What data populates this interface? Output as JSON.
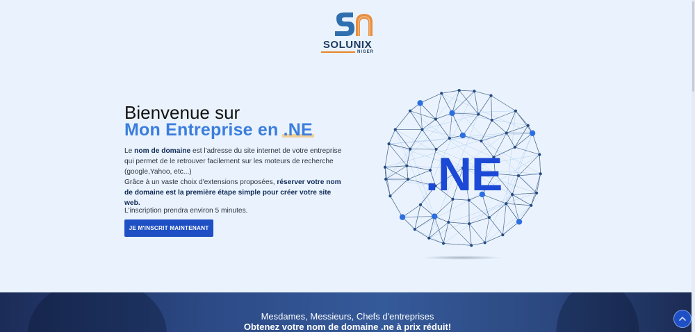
{
  "brand": {
    "name": "SOLUNIX",
    "country": "NIGER",
    "colors": {
      "blue": "#2f6fb0",
      "orange": "#e8832a",
      "navy": "#1e3a5f"
    }
  },
  "hero": {
    "title": "Bienvenue sur",
    "subtitle_prefix": "Mon Entreprise en ",
    "subtitle_highlight": ".NE",
    "paragraph": {
      "p1_a": "Le ",
      "p1_bold": "nom de domaine",
      "p1_b": " est l'adresse du site internet de votre entreprise qui permet de le retrouver facilement sur les moteurs de recherche (google,Yahoo, etc...)",
      "p2_a": "Grâce à un vaste choix d'extensions proposées, ",
      "p2_bold": "réserver votre nom de domaine est la première étape simple pour créer votre site web."
    },
    "note": "L'inscription prendra environ 5 minutes.",
    "cta_label": "JE M'INSCRIT MAINTENANT",
    "globe_label": ".NE",
    "accent": "#3b7ddd",
    "cta_color": "#1f4fc4"
  },
  "band": {
    "line1": "Mesdames, Messieurs, Chefs d'entreprises",
    "line2": "Obtenez votre nom de domaine .ne à prix réduit!"
  },
  "icons": {
    "scroll_top": "chevron-up-icon"
  }
}
